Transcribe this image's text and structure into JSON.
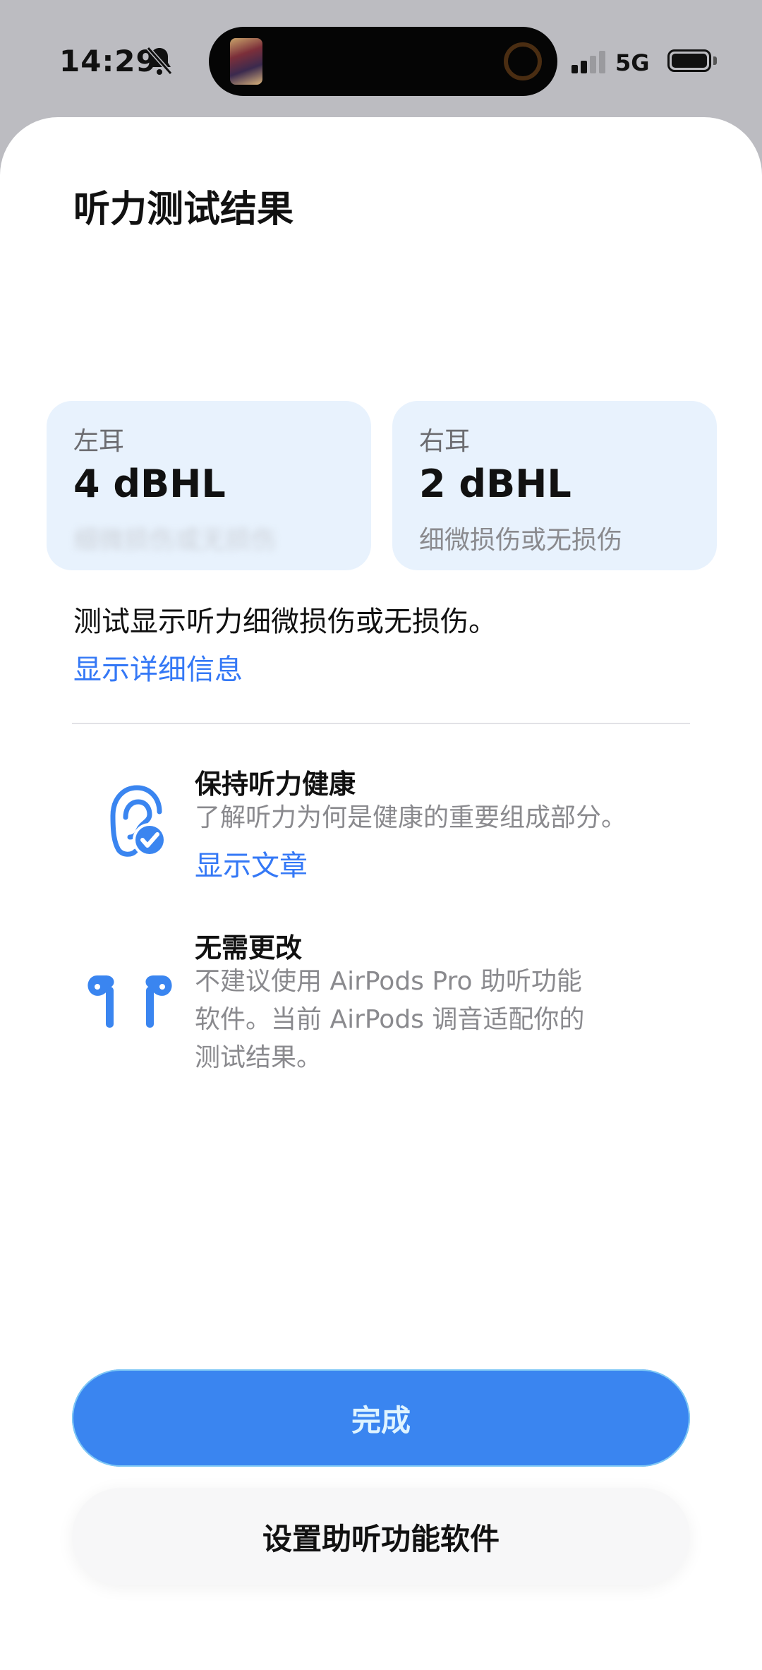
{
  "status_bar": {
    "time": "14:29",
    "network": "5G",
    "icons": [
      "bell-off-icon",
      "signal-icon",
      "battery-icon"
    ]
  },
  "page": {
    "title": "听力测试结果"
  },
  "left_ear": {
    "label": "左耳",
    "value": "4 dBHL",
    "status": "细微损伤或无损伤"
  },
  "right_ear": {
    "label": "右耳",
    "value": "2 dBHL",
    "status": "细微损伤或无损伤"
  },
  "summary": {
    "text": "测试显示听力细微损伤或无损伤。",
    "link": "显示详细信息"
  },
  "rows": {
    "healthy": {
      "icon": "ear-check-icon",
      "title": "保持听力健康",
      "text": "了解听力为何是健康的重要组成部分。",
      "link": "显示文章"
    },
    "no_change": {
      "icon": "airpods-icon",
      "title": "无需更改",
      "text": "不建议使用 AirPods Pro 助听功能\n软件。当前 AirPods 调音适配你的\n测试结果。"
    }
  },
  "buttons": {
    "done": "完成",
    "setup": "设置助听功能软件"
  },
  "colors": {
    "accent": "#3478f6",
    "card_bg": "#e8f2fd",
    "primary_button": "#3a85f0"
  }
}
